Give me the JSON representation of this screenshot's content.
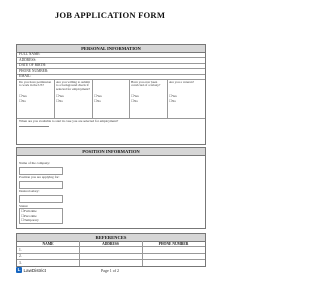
{
  "title": "JOB APPLICATION FORM",
  "personal": {
    "header": "PERSONAL INFORMATION",
    "fields": [
      "FULL NAME:",
      "ADDRESS:",
      "DATE OF BIRTH:",
      "PHONE NUMBER:",
      "EMAIL:"
    ],
    "questions": [
      {
        "text": "Do you have permission to work in the US?",
        "options": [
          "Yes",
          "No"
        ]
      },
      {
        "text": "Are you willing to submit to a background check if selected for employment?",
        "options": [
          "Yes",
          "No"
        ]
      },
      {
        "text": "",
        "options": [
          "Yes",
          "No"
        ]
      },
      {
        "text": "Have you ever been convicted of a felony?",
        "options": [
          "Yes",
          "No"
        ]
      },
      {
        "text": "Are you a veteran?",
        "options": [
          "Yes",
          "No"
        ]
      }
    ],
    "start_date_label": "When are you available to start in case you are selected for employment?"
  },
  "position": {
    "header": "POSITION INFORMATION",
    "company_label": "Name of the company:",
    "applying_label": "Position you are applying for:",
    "salary_label": "Desired salary:",
    "status_label": "Status:",
    "status_options": [
      "Full-time",
      "Part-time",
      "Temporary"
    ]
  },
  "references": {
    "header": "REFERENCES",
    "columns": [
      "NAME",
      "ADDRESS",
      "PHONE NUMBER"
    ],
    "rows": [
      "1.",
      "2.",
      "3."
    ]
  },
  "footer": {
    "logo_text": "LawDistrict",
    "logo_icon": "law-district-logo-icon",
    "page": "Page 1 of 2"
  },
  "checkbox_glyph": "☐"
}
